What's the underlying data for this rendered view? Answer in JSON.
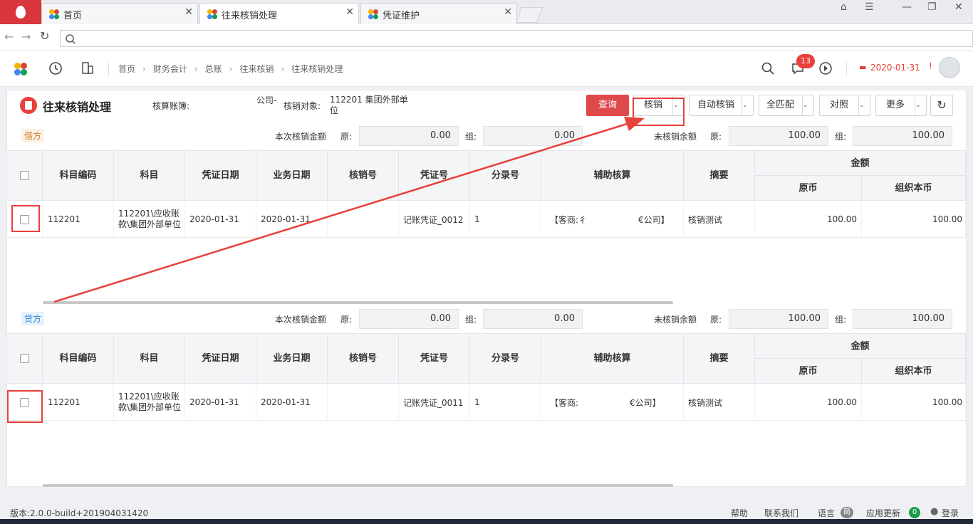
{
  "tabs": [
    {
      "label": "首页"
    },
    {
      "label": "往来核销处理"
    },
    {
      "label": "凭证维护"
    }
  ],
  "breadcrumb": [
    "首页",
    "财务会计",
    "总账",
    "往来核销",
    "往来核销处理"
  ],
  "notif_count": "13",
  "date": "2020-01-31",
  "page": {
    "title": "往来核销处理",
    "ledger_label": "核算账簿:",
    "ledger_value": "公司-",
    "target_label": "核销对象:",
    "target_value": "112201 集团外部单位"
  },
  "buttons": {
    "query": "查询",
    "verify": "核销",
    "auto": "自动核销",
    "match": "全匹配",
    "compare": "对照",
    "more": "更多"
  },
  "debit": {
    "tag": "借方",
    "this_amount_label": "本次核销金额",
    "orig_label": "原:",
    "org_label": "组:",
    "this_orig": "0.00",
    "this_org": "0.00",
    "remain_label": "未核销余额",
    "remain_orig": "100.00",
    "remain_org": "100.00"
  },
  "credit": {
    "tag": "贷方",
    "this_amount_label": "本次核销金额",
    "orig_label": "原:",
    "org_label": "组:",
    "this_orig": "0.00",
    "this_org": "0.00",
    "remain_label": "未核销余额",
    "remain_orig": "100.00",
    "remain_org": "100.00"
  },
  "columns": {
    "code": "科目编码",
    "subject": "科目",
    "voucher_date": "凭证日期",
    "biz_date": "业务日期",
    "verify_no": "核销号",
    "voucher_no": "凭证号",
    "entry_no": "分录号",
    "aux": "辅助核算",
    "summary": "摘要",
    "amount": "金额",
    "orig": "原币",
    "org": "组织本币"
  },
  "debit_row": {
    "code": "112201",
    "subject": "112201\\应收账款\\集团外部单位",
    "voucher_date": "2020-01-31",
    "biz_date": "2020-01-31",
    "verify_no": "",
    "voucher_no": "记账凭证_0012",
    "entry_no": "1",
    "aux_left": "【客商:彳",
    "aux_right": "€公司】",
    "summary": "核销测试",
    "orig": "100.00",
    "org": "100.00"
  },
  "credit_row": {
    "code": "112201",
    "subject": "112201\\应收账款\\集团外部单位",
    "voucher_date": "2020-01-31",
    "biz_date": "2020-01-31",
    "verify_no": "",
    "voucher_no": "记账凭证_0011",
    "entry_no": "1",
    "aux_left": "【客商:",
    "aux_right": "€公司】",
    "summary": "核销测试",
    "orig": "100.00",
    "org": "100.00"
  },
  "footer": {
    "version": "版本:2.0.0-build+201904031420",
    "help": "帮助",
    "contact": "联系我们",
    "language": "语言",
    "update": "应用更新",
    "update_count": "0",
    "login": "登录"
  },
  "colors": {
    "accent": "#e8403a",
    "brand": "#d9363e"
  }
}
